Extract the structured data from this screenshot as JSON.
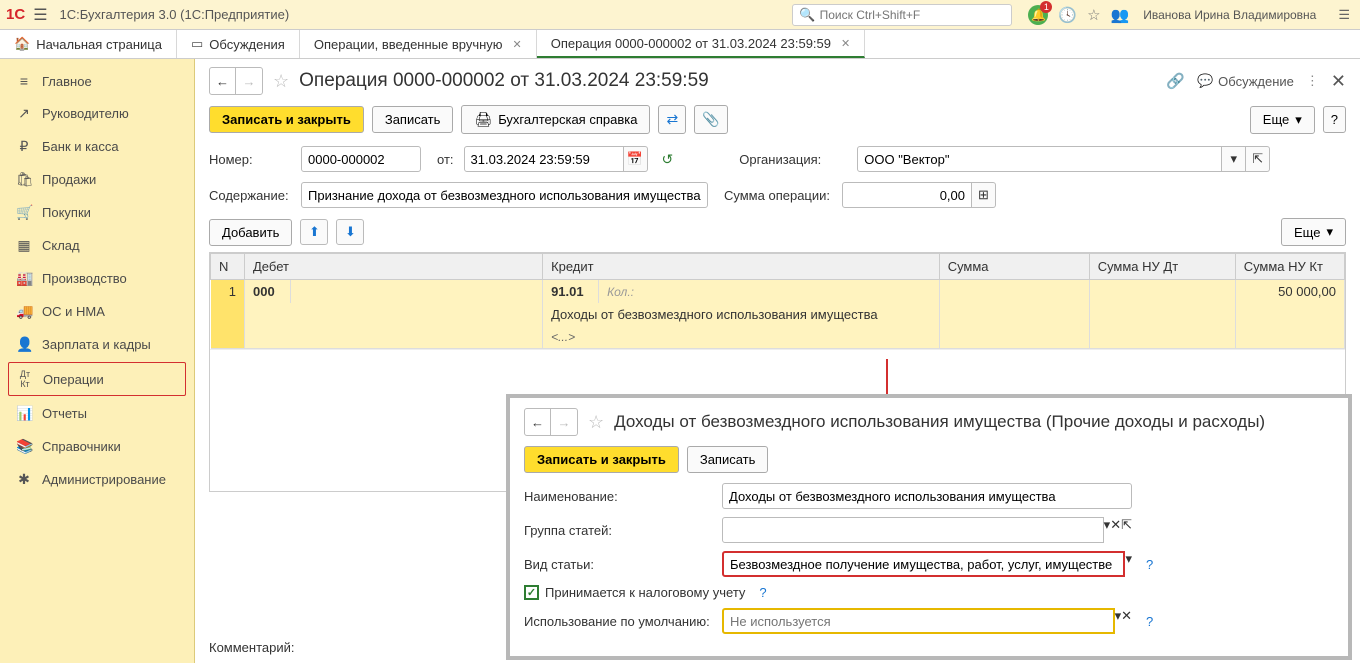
{
  "topbar": {
    "logo": "1С",
    "app_title": "1С:Бухгалтерия 3.0  (1С:Предприятие)",
    "search_placeholder": "Поиск Ctrl+Shift+F",
    "bell_count": "1",
    "user_name": "Иванова Ирина Владимировна"
  },
  "tabs": [
    {
      "label": "Начальная страница",
      "icon": "🏠"
    },
    {
      "label": "Обсуждения",
      "icon": "💬"
    },
    {
      "label": "Операции, введенные вручную",
      "closable": true
    },
    {
      "label": "Операция 0000-000002 от 31.03.2024 23:59:59",
      "closable": true,
      "active": true
    }
  ],
  "sidebar": {
    "items": [
      {
        "icon": "≡",
        "label": "Главное"
      },
      {
        "icon": "📈",
        "label": "Руководителю"
      },
      {
        "icon": "₽",
        "label": "Банк и касса"
      },
      {
        "icon": "🛍",
        "label": "Продажи"
      },
      {
        "icon": "🛒",
        "label": "Покупки"
      },
      {
        "icon": "▦",
        "label": "Склад"
      },
      {
        "icon": "🏭",
        "label": "Производство"
      },
      {
        "icon": "🚚",
        "label": "ОС и НМА"
      },
      {
        "icon": "👤",
        "label": "Зарплата и кадры"
      },
      {
        "icon": "Дт/Кт",
        "label": "Операции",
        "highlighted": true
      },
      {
        "icon": "📊",
        "label": "Отчеты"
      },
      {
        "icon": "📚",
        "label": "Справочники"
      },
      {
        "icon": "✱",
        "label": "Администрирование"
      }
    ]
  },
  "document": {
    "title": "Операция 0000-000002 от 31.03.2024 23:59:59",
    "discussion_label": "Обсуждение",
    "toolbar": {
      "save_close": "Записать и закрыть",
      "save": "Записать",
      "print": "Бухгалтерская справка",
      "more": "Еще"
    },
    "fields": {
      "number_label": "Номер:",
      "number_value": "0000-000002",
      "date_label": "от:",
      "date_value": "31.03.2024 23:59:59",
      "org_label": "Организация:",
      "org_value": "ООО \"Вектор\"",
      "content_label": "Содержание:",
      "content_value": "Признание дохода от безвозмездного использования имущества",
      "sum_label": "Сумма операции:",
      "sum_value": "0,00"
    },
    "table": {
      "add_btn": "Добавить",
      "more": "Еще",
      "columns": {
        "n": "N",
        "debit": "Дебет",
        "credit": "Кредит",
        "sum": "Сумма",
        "sum_nu_dt": "Сумма НУ Дт",
        "sum_nu_kt": "Сумма НУ Кт"
      },
      "rows": [
        {
          "n": "1",
          "debit": "000",
          "credit": "91.01",
          "kol": "Кол.:",
          "credit_sub1": "Доходы от безвозмездного использования имущества",
          "credit_sub2": "<...>",
          "sum_nu_kt": "50 000,00"
        }
      ]
    },
    "comment_label": "Комментарий:"
  },
  "panel": {
    "title": "Доходы от безвозмездного использования имущества (Прочие доходы и расходы)",
    "save_close": "Записать и закрыть",
    "save": "Записать",
    "fields": {
      "name_label": "Наименование:",
      "name_value": "Доходы от безвозмездного использования имущества",
      "group_label": "Группа статей:",
      "group_value": "",
      "kind_label": "Вид статьи:",
      "kind_value": "Безвозмездное получение имущества, работ, услуг, имуществе",
      "tax_checkbox": "Принимается к налоговому учету",
      "default_label": "Использование по умолчанию:",
      "default_placeholder": "Не используется"
    }
  }
}
